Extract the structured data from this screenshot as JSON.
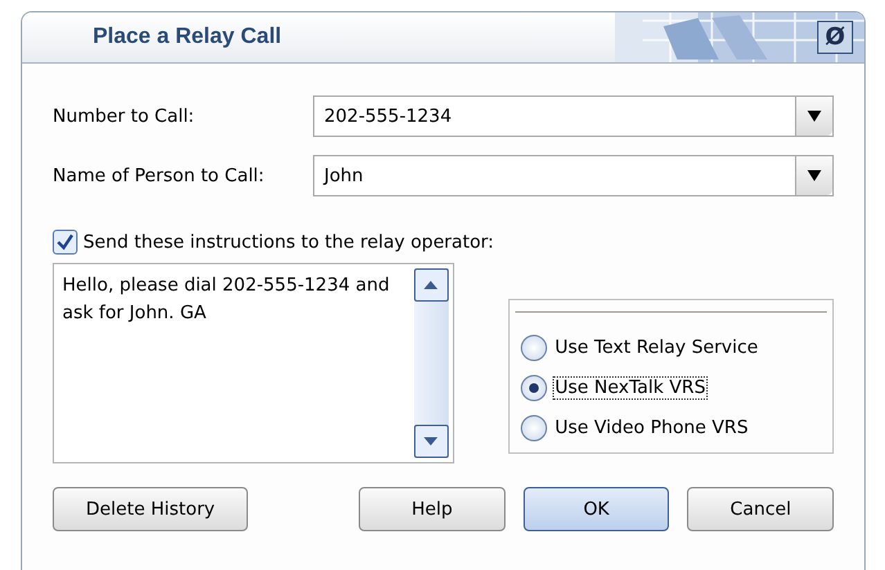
{
  "window": {
    "title": "Place a Relay Call",
    "close_glyph": "Ø"
  },
  "fields": [
    {
      "label": "Number to Call:",
      "value": "202-555-1234"
    },
    {
      "label": "Name of Person to Call:",
      "value": "John"
    }
  ],
  "send_instructions": {
    "label": "Send these instructions to the relay operator:",
    "checked": true
  },
  "instructions": {
    "value": "Hello, please dial 202-555-1234 and ask for John. GA"
  },
  "services": [
    {
      "label": "Use Text Relay Service",
      "selected": false
    },
    {
      "label": "Use NexTalk VRS",
      "selected": true
    },
    {
      "label": "Use Video Phone VRS",
      "selected": false
    }
  ],
  "buttons": [
    {
      "label": "Delete History",
      "default": false
    },
    {
      "label": "Help",
      "default": false
    },
    {
      "label": "OK",
      "default": true
    },
    {
      "label": "Cancel",
      "default": false
    }
  ]
}
